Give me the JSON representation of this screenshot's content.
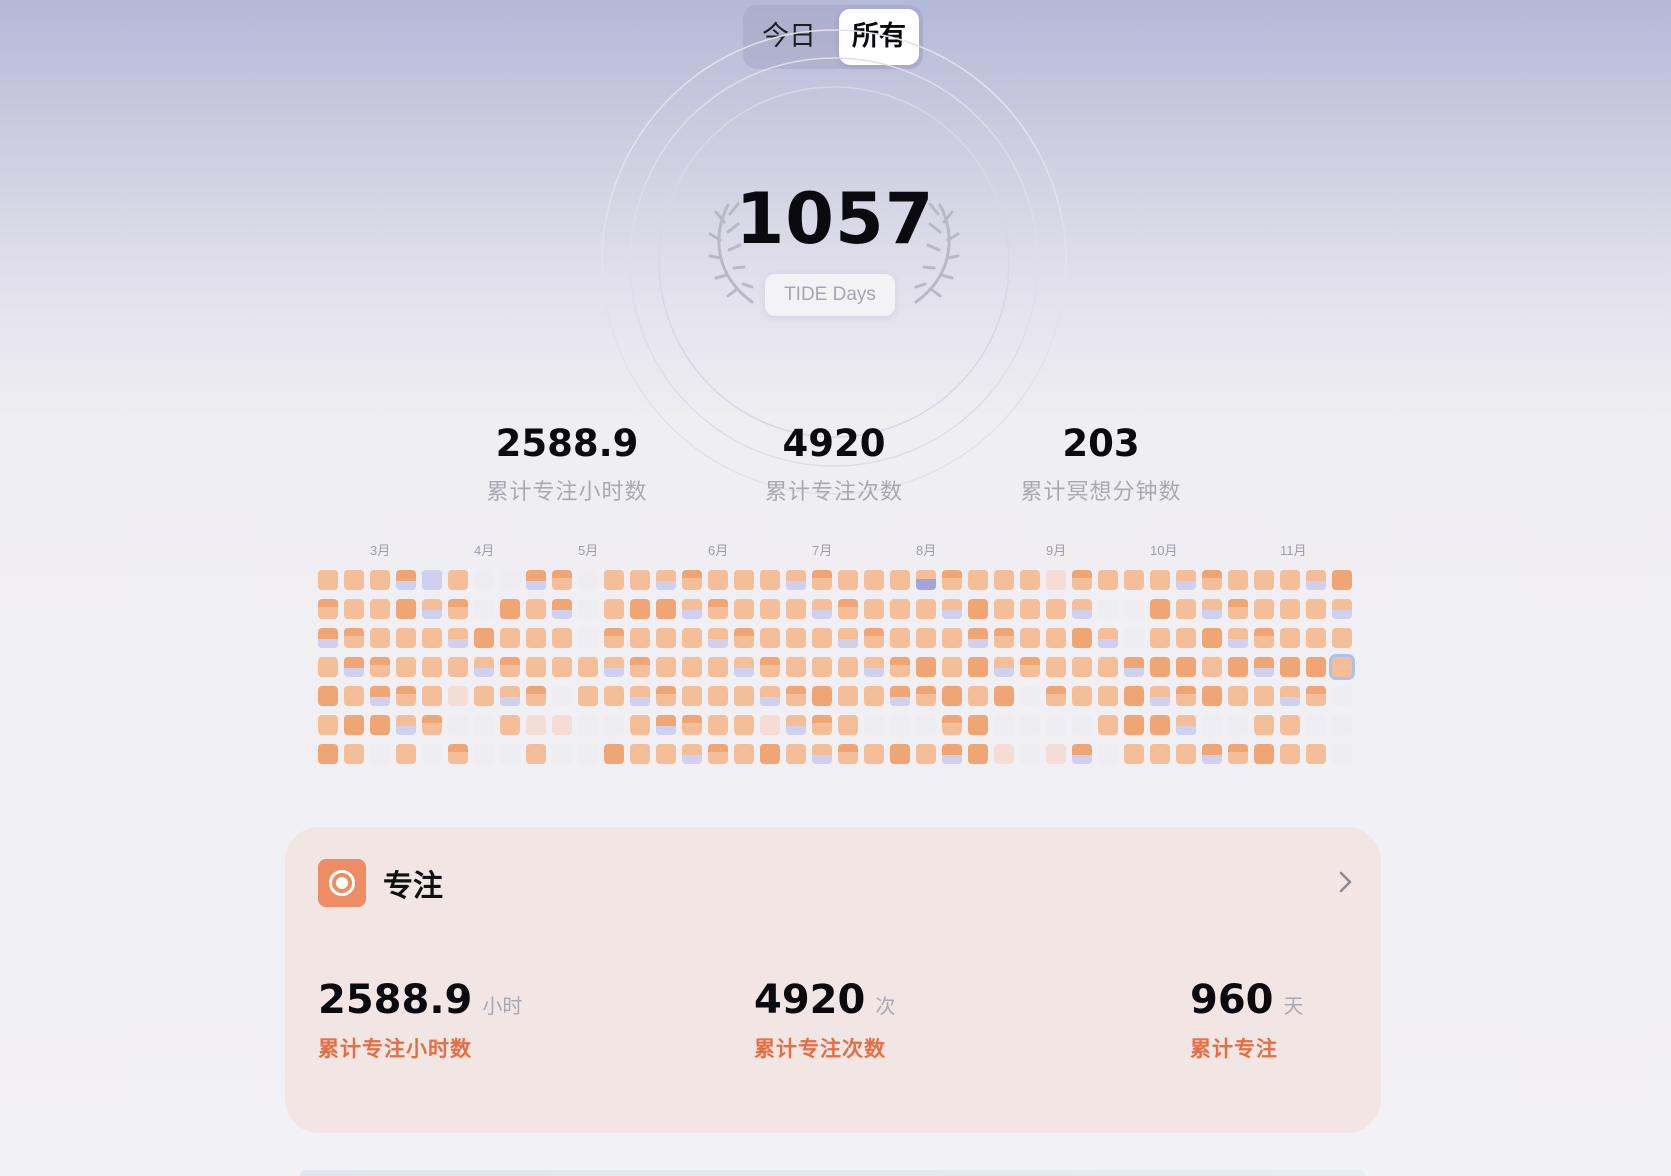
{
  "toggle": {
    "today": "今日",
    "all": "所有",
    "selected": "all"
  },
  "hero": {
    "days": "1057",
    "pill": "TIDE Days"
  },
  "stats": [
    {
      "value": "2588.9",
      "label": "累计专注小时数"
    },
    {
      "value": "4920",
      "label": "累计专注次数"
    },
    {
      "value": "203",
      "label": "累计冥想分钟数"
    }
  ],
  "heatmap": {
    "months": [
      "3月",
      "4月",
      "5月",
      "6月",
      "7月",
      "8月",
      "9月",
      "10月",
      "11月"
    ],
    "month_start_col": [
      2,
      6,
      10,
      15,
      19,
      23,
      28,
      32,
      37
    ],
    "colors": {
      "empty": "#eeedf2",
      "faint": "#f5ddd6",
      "light": "#f4bf98",
      "dark": "#f0a574",
      "lavender": "#cfd0ee",
      "purple": "#a2a4e1"
    },
    "today": {
      "col": 39,
      "row": 3
    },
    "cells": [
      "LLLDVLEEDLELLLLLLLLLLLLLLLLLFLLLLLLLLLLD",
      "LLLDLLEDLDELDDLLLLLLLLLLLDLLLLEEDLLLLLLL",
      "DLLLLLDLLLELLLLLLLLLLLLLLDLLLDLELLDLLLLL",
      "LDLLLLLLLLLLLLLLLLLLLLLDLDLLLLLDDDLDDDDL",
      "DLDLLFLLLELLLLLLLLLDLLDLDLDELLLDLLDLLLLE",
      "LDDLLEELFFEELDLLLFLLLEEELDEEEELDDLEELLEE",
      "DLELELEELEEDLLLLLDLLLLDLDDFEFDELLLDLDLLE"
    ]
  },
  "focus_card": {
    "title": "专注",
    "metrics": [
      {
        "value": "2588.9",
        "unit": "小时",
        "label": "累计专注小时数"
      },
      {
        "value": "4920",
        "unit": "次",
        "label": "累计专注次数"
      },
      {
        "value": "960",
        "unit": "天",
        "label": "累计专注"
      }
    ]
  }
}
